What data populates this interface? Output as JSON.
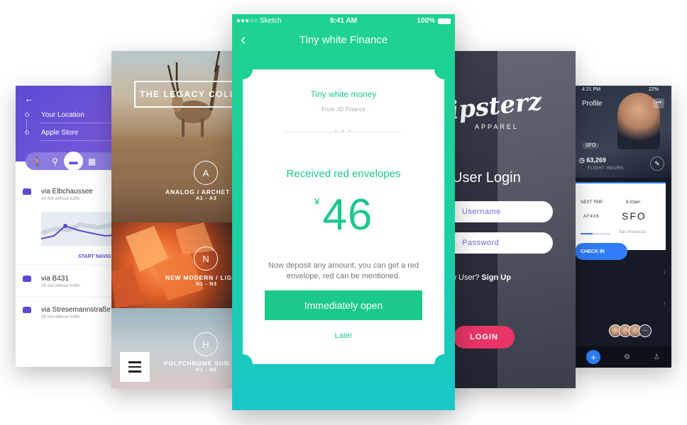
{
  "map": {
    "your_location": "Your Location",
    "destination": "Apple Store",
    "routes": [
      {
        "name": "via Elbchaussee",
        "sub": "24 min without traffic"
      },
      {
        "name": "via B431",
        "sub": "26 min without traffic"
      },
      {
        "name": "via Stresemannstraße",
        "sub": "28 min without traffic"
      }
    ],
    "start_nav": "START NAVIG"
  },
  "legacy": {
    "title": "THE LEGACY COLL",
    "collections": [
      {
        "letter": "A",
        "title": "ANALOG / ARCHET",
        "sub": "A1 - A3"
      },
      {
        "letter": "N",
        "title": "NEW MODERN / LIG",
        "sub": "N1 - N3"
      },
      {
        "letter": "H",
        "title": "POLYCHROME SUM",
        "sub": "H1 - H3"
      }
    ]
  },
  "finance": {
    "status": {
      "carrier": "●●●○○ Sketch",
      "time": "9:41 AM",
      "battery": "100%"
    },
    "nav_title": "Tiny white Finance",
    "product": "Tiny white money",
    "from": "From JD Finance",
    "received": "Received red envelopes",
    "currency": "¥",
    "amount": "46",
    "description": "Now deposit any amount, you can get a red envelope, red can be mentioned.",
    "open_button": "Immediately open",
    "later": "Later",
    "accent": "#1dc98a"
  },
  "hipsterz": {
    "brand": "ipsterz",
    "apparel": "APPAREL",
    "title": "User Login",
    "username_placeholder": "Username",
    "password_placeholder": "Password",
    "new_user": "w User?",
    "sign_up": "Sign Up",
    "login_button": "LOGIN"
  },
  "flight": {
    "time": "4:21 PM",
    "battery": "22%",
    "title": "Profile",
    "airport_tag": "SFO",
    "hours": "63,269",
    "hours_label": "FLIGHT HOURS",
    "next_trip": "NEXT TRIP",
    "trip_time": "8:20am",
    "flight_no": "AF436",
    "dest_code": "SFO",
    "dest_city": "San Francisco",
    "checkin": "CHECK IN"
  }
}
